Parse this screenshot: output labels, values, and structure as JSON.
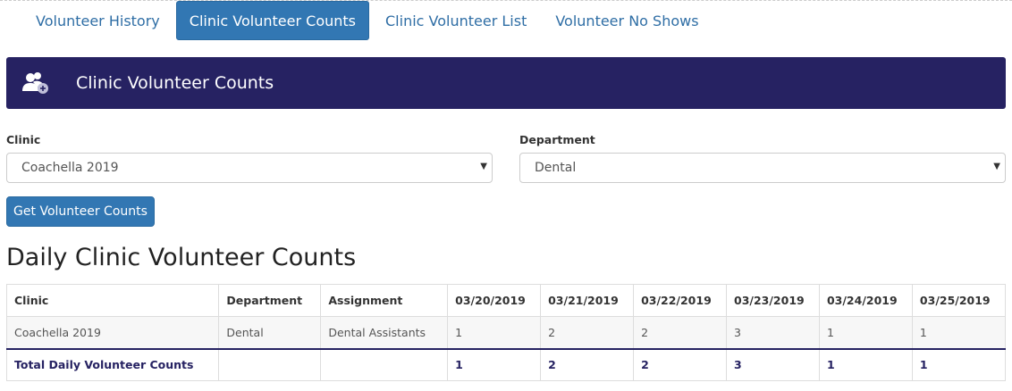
{
  "tabs": [
    {
      "label": "Volunteer History",
      "active": false
    },
    {
      "label": "Clinic Volunteer Counts",
      "active": true
    },
    {
      "label": "Clinic Volunteer List",
      "active": false
    },
    {
      "label": "Volunteer No Shows",
      "active": false
    }
  ],
  "banner": {
    "title": "Clinic Volunteer Counts",
    "icon": "users-icon",
    "color": "#262262"
  },
  "filters": {
    "clinic": {
      "label": "Clinic",
      "value": "Coachella 2019"
    },
    "department": {
      "label": "Department",
      "value": "Dental"
    },
    "submit_label": "Get Volunteer Counts"
  },
  "section_title": "Daily Clinic Volunteer Counts",
  "table": {
    "headers": [
      "Clinic",
      "Department",
      "Assignment",
      "03/20/2019",
      "03/21/2019",
      "03/22/2019",
      "03/23/2019",
      "03/24/2019",
      "03/25/2019"
    ],
    "rows": [
      [
        "Coachella 2019",
        "Dental",
        "Dental Assistants",
        "1",
        "2",
        "2",
        "3",
        "1",
        "1"
      ]
    ],
    "total": [
      "Total Daily Volunteer Counts",
      "",
      "",
      "1",
      "2",
      "2",
      "3",
      "1",
      "1"
    ]
  },
  "colors": {
    "accent": "#3277b3",
    "brand_dark": "#262262"
  }
}
